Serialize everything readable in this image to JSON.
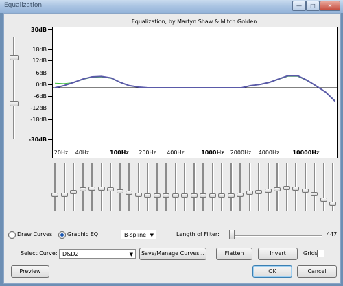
{
  "window": {
    "title": "Equalization",
    "min_icon": "minimize-icon",
    "max_icon": "maximize-icon",
    "close_icon": "close-icon"
  },
  "graph": {
    "title": "Equalization, by Martyn Shaw & Mitch Golden",
    "y_labels": [
      "30dB",
      "18dB",
      "12dB",
      "6dB",
      "0dB",
      "-6dB",
      "-12dB",
      "-18dB",
      "-30dB"
    ],
    "x_labels": [
      "20Hz",
      "40Hz",
      "100Hz",
      "200Hz",
      "400Hz",
      "1000Hz",
      "2000Hz",
      "4000Hz",
      "10000Hz"
    ],
    "x_bold": [
      false,
      false,
      true,
      false,
      false,
      true,
      false,
      false,
      true
    ],
    "curve_color": "#5a5aa8",
    "flat_curve_color": "#3fbf3f",
    "zero_line_color": "#000000"
  },
  "chart_data": {
    "type": "line",
    "x_scale": "log",
    "ylim": [
      -30,
      30
    ],
    "series": [
      {
        "x": [
          20,
          25,
          32,
          40,
          50,
          63,
          80,
          100,
          125,
          160,
          200,
          250,
          315,
          400,
          500,
          630,
          800,
          1000,
          1250,
          1600,
          2000,
          2500,
          3150,
          4000,
          5000,
          6300,
          8000,
          10000,
          12500,
          16000,
          20000
        ],
        "y": [
          0,
          1,
          2.5,
          4,
          5,
          5.2,
          4.5,
          2.5,
          1,
          0.3,
          0,
          0,
          0,
          0,
          0,
          0,
          0,
          0,
          0,
          0,
          0,
          1,
          1.5,
          2.5,
          4,
          5.5,
          5.5,
          3.5,
          1,
          -2,
          -6
        ]
      }
    ]
  },
  "eq_sliders": {
    "freqs": [
      20,
      25,
      31,
      40,
      50,
      63,
      80,
      100,
      125,
      160,
      200,
      250,
      315,
      400,
      500,
      630,
      800,
      1000,
      1250,
      1600,
      2000,
      2500,
      3150,
      4000,
      5000,
      6300,
      8000,
      10000,
      12500,
      16000,
      20000
    ],
    "levels": [
      0,
      0,
      1.5,
      3,
      3.5,
      3.5,
      3,
      2,
      1,
      0,
      -0.5,
      -0.5,
      -0.5,
      -0.5,
      -0.5,
      -0.5,
      -0.5,
      -0.5,
      -0.5,
      -0.5,
      0,
      1,
      1.5,
      2.5,
      3,
      4,
      3.5,
      2.5,
      0.5,
      -2.5,
      -5
    ]
  },
  "controls": {
    "draw_curves_label": "Draw Curves",
    "graphic_eq_label": "Graphic EQ",
    "mode_selected": "Graphic EQ",
    "interp_value": "B-spline",
    "length_label": "Length of Filter:",
    "length_value": "447",
    "select_curve_label": "Select Curve:",
    "curve_value": "D&D2",
    "save_manage_label": "Save/Manage Curves...",
    "flatten_label": "Flatten",
    "invert_label": "Invert",
    "grids_label": "Grids",
    "preview_label": "Preview",
    "ok_label": "OK",
    "cancel_label": "Cancel"
  }
}
